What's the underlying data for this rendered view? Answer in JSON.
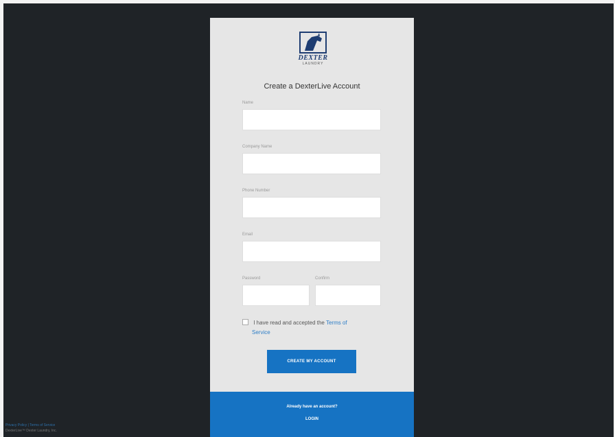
{
  "brand": {
    "wordmark": "DEXTER",
    "tagline": "LAUNDRY"
  },
  "form": {
    "title": "Create a DexterLive Account",
    "fields": [
      {
        "label": "Name",
        "value": ""
      },
      {
        "label": "Company Name",
        "value": ""
      },
      {
        "label": "Phone Number",
        "value": ""
      },
      {
        "label": "Email",
        "value": ""
      },
      {
        "label": "Password",
        "value": ""
      },
      {
        "label": "Confirm",
        "value": ""
      }
    ],
    "terms_prefix": "I have read and accepted the",
    "terms_link_1": "Terms of",
    "terms_link_2": "Service",
    "submit_label": "Create my account"
  },
  "footer": {
    "question": "Already have an account?",
    "login_label": "Login"
  },
  "corner": {
    "links": "Privacy Policy | Terms of Service",
    "copyright": "DexterLive™ Dexter Laundry, Inc."
  },
  "colors": {
    "background": "#1f2327",
    "card": "#e6e6e6",
    "accent": "#1673c3",
    "link": "#2d7dc6"
  }
}
